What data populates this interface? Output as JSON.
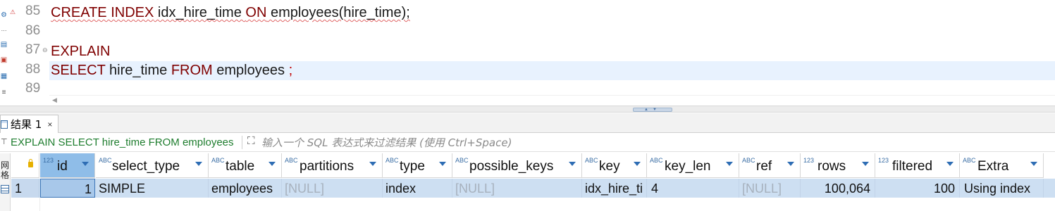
{
  "editor": {
    "lines": [
      {
        "number": "85",
        "tokens": [
          {
            "t": "CREATE INDEX",
            "kw": true
          },
          {
            "t": " idx_hire_time ",
            "kw": false
          },
          {
            "t": "ON",
            "kw": true
          },
          {
            "t": " employees(hire_time);",
            "kw": false
          }
        ]
      },
      {
        "number": "86",
        "tokens": []
      },
      {
        "number": "87",
        "tokens": [
          {
            "t": "EXPLAIN",
            "kw": true
          }
        ]
      },
      {
        "number": "88",
        "tokens": [
          {
            "t": "SELECT",
            "kw": true
          },
          {
            "t": " hire_time ",
            "kw": false
          },
          {
            "t": "FROM",
            "kw": true
          },
          {
            "t": " employees ",
            "kw": false
          },
          {
            "t": ";",
            "kw": true
          }
        ]
      },
      {
        "number": "89",
        "tokens": []
      }
    ],
    "warning_marker": "⚠",
    "fold_marker": "⊖",
    "scroll_left_arrow": "◀"
  },
  "results": {
    "tab_label": "结果 1",
    "tab_close": "×",
    "query_text": "EXPLAIN SELECT hire_time FROM employees",
    "query_icon": "⊤",
    "expand_icon": "⛶",
    "filter_placeholder": "输入一个 SQL 表达式来过滤结果 (使用 Ctrl+Space)",
    "side_tab_text": "网格",
    "columns": [
      {
        "type": "123",
        "label": "id",
        "selected": true
      },
      {
        "type": "ABC",
        "label": "select_type",
        "selected": false
      },
      {
        "type": "ABC",
        "label": "table",
        "selected": false
      },
      {
        "type": "ABC",
        "label": "partitions",
        "selected": false
      },
      {
        "type": "ABC",
        "label": "type",
        "selected": false
      },
      {
        "type": "ABC",
        "label": "possible_keys",
        "selected": false
      },
      {
        "type": "ABC",
        "label": "key",
        "selected": false
      },
      {
        "type": "ABC",
        "label": "key_len",
        "selected": false
      },
      {
        "type": "ABC",
        "label": "ref",
        "selected": false
      },
      {
        "type": "123",
        "label": "rows",
        "selected": false
      },
      {
        "type": "123",
        "label": "filtered",
        "selected": false
      },
      {
        "type": "ABC",
        "label": "Extra",
        "selected": false
      }
    ],
    "rows": [
      {
        "row_number": "1",
        "cells": [
          "1",
          "SIMPLE",
          "employees",
          "[NULL]",
          "index",
          "[NULL]",
          "idx_hire_ti",
          "4",
          "[NULL]",
          "100,064",
          "100",
          "Using index"
        ]
      }
    ]
  }
}
